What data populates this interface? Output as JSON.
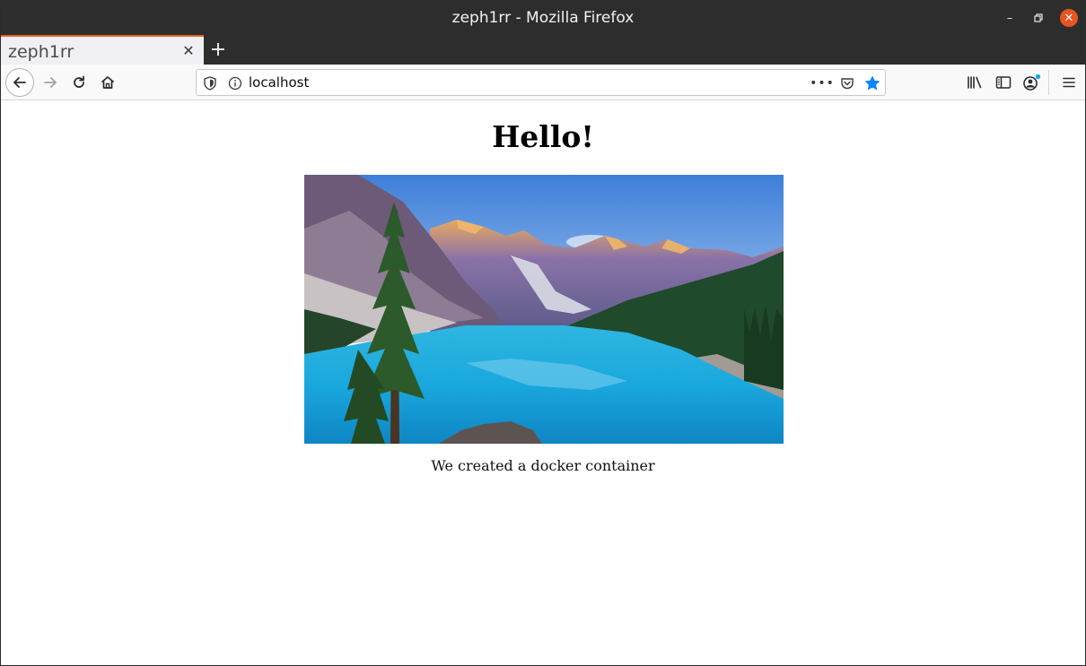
{
  "window": {
    "title": "zeph1rr - Mozilla Firefox",
    "controls": {
      "minimize": "–",
      "maximize": "▫",
      "close": "✕"
    }
  },
  "tabs": [
    {
      "label": "zeph1rr",
      "close": "✕"
    }
  ],
  "new_tab": "+",
  "navbar": {
    "url": "localhost",
    "more": "•••"
  },
  "page": {
    "heading": "Hello!",
    "image_alt": "mountain lake landscape",
    "caption": "We created a docker container"
  },
  "colors": {
    "tab_accent": "#e96221",
    "close_button": "#e95420",
    "bookmark_star": "#0a84ff"
  }
}
